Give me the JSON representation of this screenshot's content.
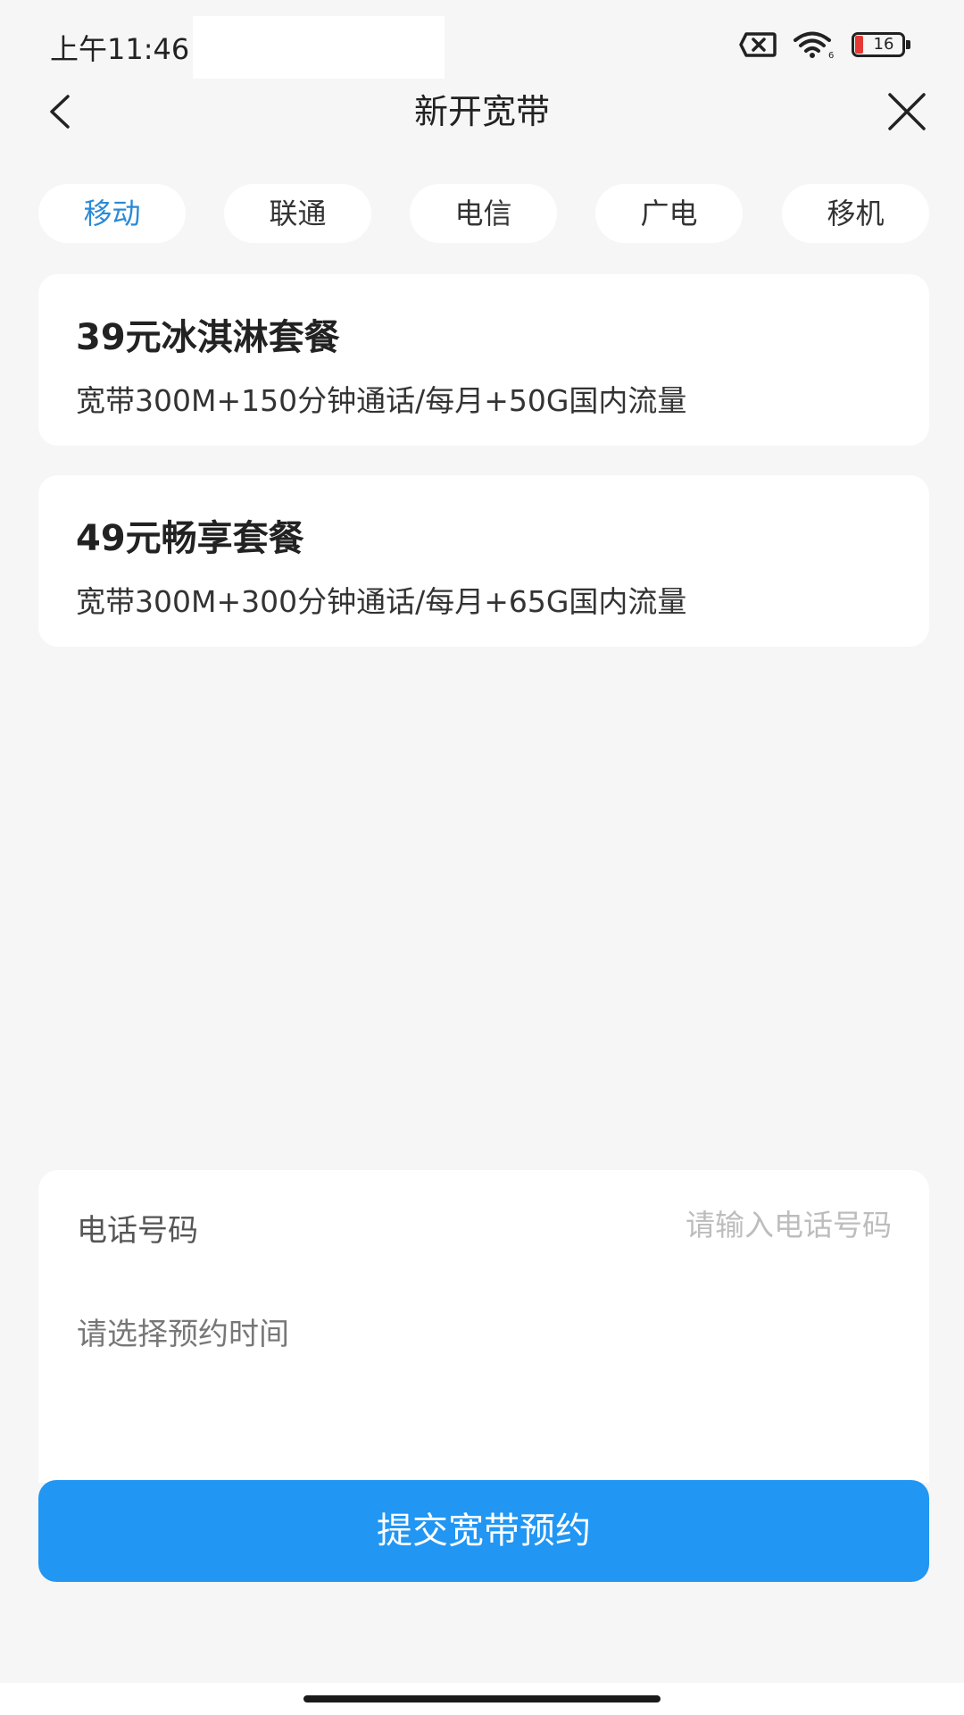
{
  "status_bar": {
    "time": "上午11:46",
    "battery_level": "16",
    "icons": [
      "sim-error-icon",
      "wifi-icon",
      "battery-icon"
    ],
    "battery_level_color": "#e53935"
  },
  "nav": {
    "title": "新开宽带",
    "back_icon": "chevron-left-icon",
    "close_icon": "close-icon"
  },
  "carrier_tabs": {
    "active_index": 0,
    "active_color": "#2a8ad8",
    "items": [
      {
        "label": "移动"
      },
      {
        "label": "联通"
      },
      {
        "label": "电信"
      },
      {
        "label": "广电"
      },
      {
        "label": "移机"
      }
    ]
  },
  "plans": [
    {
      "title": "39元冰淇淋套餐",
      "description": "宽带300M+150分钟通话/每月+50G国内流量"
    },
    {
      "title": "49元畅享套餐",
      "description": "宽带300M+300分钟通话/每月+65G国内流量"
    }
  ],
  "form": {
    "phone_label": "电话号码",
    "phone_value": "",
    "phone_placeholder": "请输入电话号码",
    "time_select_placeholder": "请选择预约时间"
  },
  "submit": {
    "label": "提交宽带预约",
    "color": "#2196f3"
  }
}
